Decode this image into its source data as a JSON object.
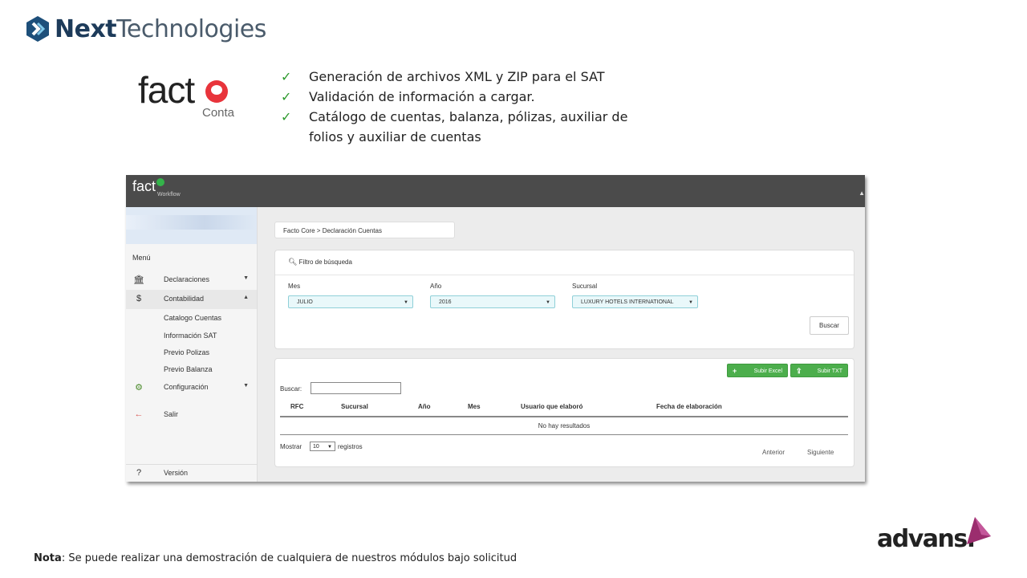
{
  "slide": {
    "brand_logo": {
      "bold": "Next",
      "rest": "Technologies"
    },
    "product_logo": {
      "word": "fact",
      "sub": "Conta"
    },
    "features": [
      "Generación de archivos XML y ZIP para el SAT",
      "Validación de información a cargar.",
      "Catálogo de cuentas, balanza, pólizas, auxiliar de folios y auxiliar de cuentas"
    ],
    "note": {
      "label": "Nota",
      "text": ": Se puede realizar una demostración de cualquiera de nuestros módulos bajo solicitud"
    },
    "partner_logo": "advans."
  },
  "app": {
    "topbar": {
      "logo": "fact",
      "sub": "Workflow"
    },
    "sidebar": {
      "menu_label": "Menú",
      "items": [
        {
          "label": "Declaraciones",
          "icon": "bank-icon"
        },
        {
          "label": "Contabilidad",
          "icon": "dollar-icon"
        },
        {
          "label": "Configuración",
          "icon": "gears-icon"
        },
        {
          "label": "Salir",
          "icon": "exit-arrow-icon"
        },
        {
          "label": "Versión",
          "icon": "question-icon"
        }
      ],
      "subitems": [
        "Catalogo Cuentas",
        "Información SAT",
        "Previo Polizas",
        "Previo Balanza"
      ]
    },
    "breadcrumb": "Facto Core > Declaración Cuentas",
    "filter": {
      "title": "Filtro de búsqueda",
      "mes_label": "Mes",
      "mes_value": "JULIO",
      "anio_label": "Año",
      "anio_value": "2016",
      "sucursal_label": "Sucursal",
      "sucursal_value": "LUXURY HOTELS INTERNATIONAL",
      "search_button": "Buscar"
    },
    "results": {
      "upload_excel": "Subir Excel",
      "upload_txt": "Subir TXT",
      "search_label": "Buscar:",
      "columns": [
        "RFC",
        "Sucursal",
        "Año",
        "Mes",
        "Usuario que elaboró",
        "Fecha de elaboración"
      ],
      "empty_message": "No hay resultados",
      "show_label": "Mostrar",
      "show_value": "10",
      "records_label": "registros",
      "prev": "Anterior",
      "next": "Siguiente"
    }
  }
}
